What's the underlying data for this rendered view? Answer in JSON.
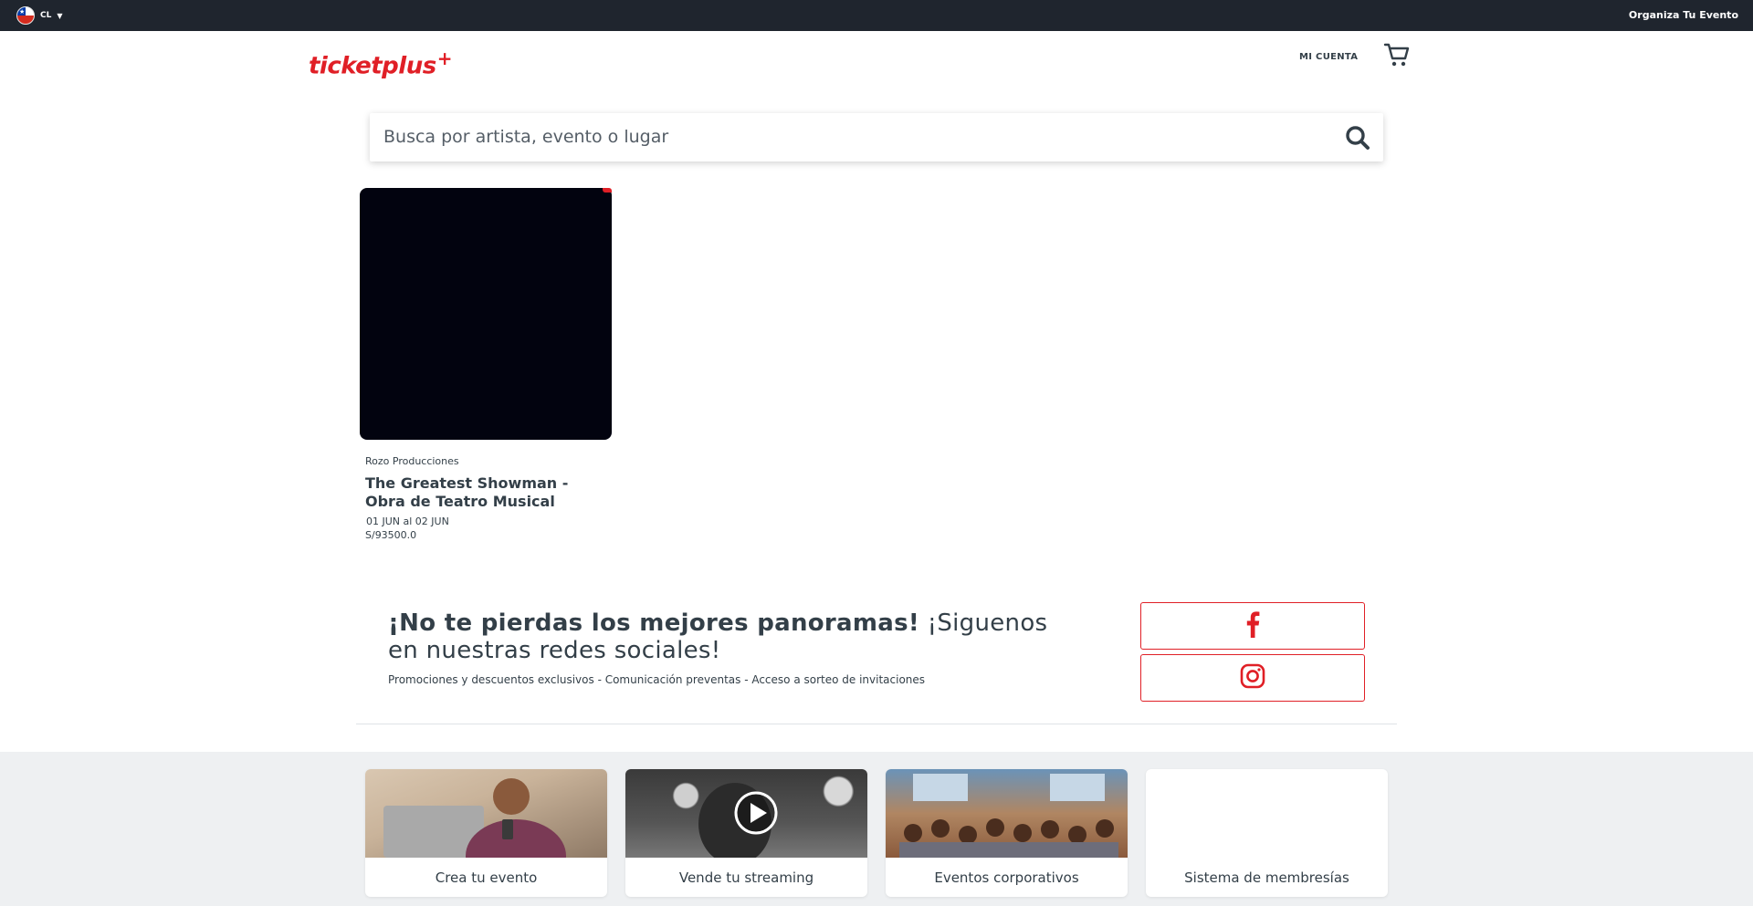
{
  "topbar": {
    "country_code": "CL",
    "organiza_label": "Organiza Tu Evento"
  },
  "header": {
    "logo_text": "ticketplus",
    "logo_plus": "+",
    "account_label": "MI CUENTA"
  },
  "search": {
    "placeholder": "Busca por artista, evento o lugar"
  },
  "events": [
    {
      "producer": "Rozo Producciones",
      "title": "The Greatest Showman - Obra de Teatro Musical",
      "dates": "01 JUN al 02 JUN",
      "price": "S/93500.0"
    }
  ],
  "promo": {
    "title_bold": "¡No te pierdas los mejores panoramas!",
    "title_rest": " ¡Siguenos en nuestras redes sociales!",
    "subtitle": "Promociones y descuentos exclusivos - Comunicación preventas - Acceso a sorteo de invitaciones"
  },
  "social": {
    "facebook_icon": "facebook-icon",
    "instagram_icon": "instagram-icon"
  },
  "tiles": [
    {
      "label": "Crea tu evento"
    },
    {
      "label": "Vende tu streaming"
    },
    {
      "label": "Eventos corporativos"
    },
    {
      "label": "Sistema de membresías"
    }
  ],
  "colors": {
    "brand_red": "#e01f26",
    "topbar_bg": "#1f252e",
    "text": "#333f48"
  }
}
